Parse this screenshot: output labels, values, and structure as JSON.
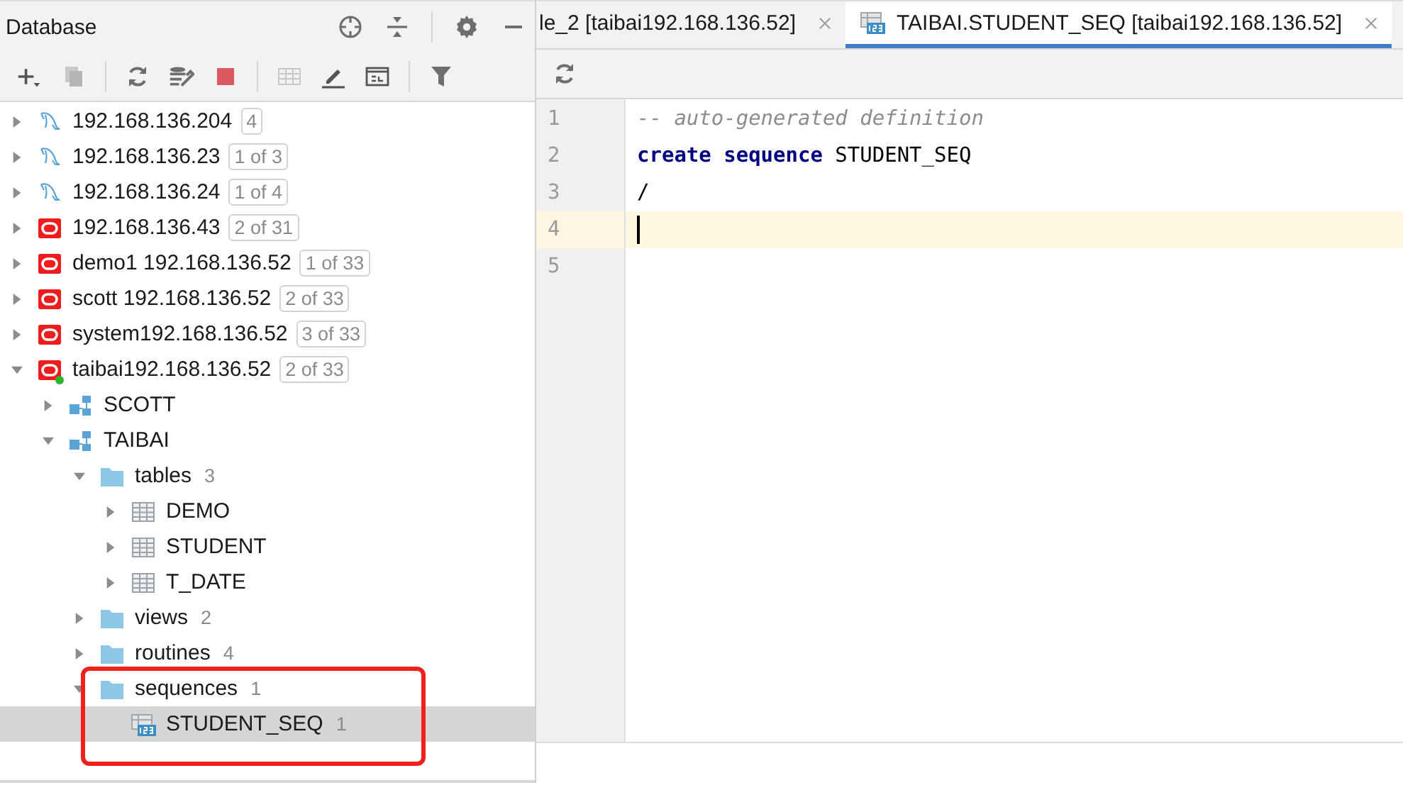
{
  "panel": {
    "title": "Database"
  },
  "tree": [
    {
      "kind": "mysql",
      "label": "192.168.136.204",
      "badge": "4",
      "expanded": false,
      "selected": false
    },
    {
      "kind": "mysql",
      "label": "192.168.136.23",
      "badge": "1 of 3",
      "expanded": false,
      "selected": false
    },
    {
      "kind": "mysql",
      "label": "192.168.136.24",
      "badge": "1 of 4",
      "expanded": false,
      "selected": false
    },
    {
      "kind": "oracle",
      "label": "192.168.136.43",
      "badge": "2 of 31",
      "expanded": false,
      "selected": false,
      "connected": false
    },
    {
      "kind": "oracle",
      "label": "demo1 192.168.136.52",
      "badge": "1 of 33",
      "expanded": false,
      "selected": false,
      "connected": false
    },
    {
      "kind": "oracle",
      "label": "scott 192.168.136.52",
      "badge": "2 of 33",
      "expanded": false,
      "selected": false,
      "connected": false
    },
    {
      "kind": "oracle",
      "label": "system192.168.136.52",
      "badge": "3 of 33",
      "expanded": false,
      "selected": false,
      "connected": false
    },
    {
      "kind": "oracle",
      "label": "taibai192.168.136.52",
      "badge": "2 of 33",
      "expanded": true,
      "selected": false,
      "connected": true,
      "children": [
        {
          "kind": "schema",
          "label": "SCOTT",
          "expanded": false,
          "selected": false
        },
        {
          "kind": "schema",
          "label": "TAIBAI",
          "expanded": true,
          "selected": false,
          "children": [
            {
              "kind": "folder",
              "label": "tables",
              "badge": "3",
              "expanded": true,
              "selected": false,
              "children": [
                {
                  "kind": "table",
                  "label": "DEMO",
                  "expanded": false,
                  "selected": false
                },
                {
                  "kind": "table",
                  "label": "STUDENT",
                  "expanded": false,
                  "selected": false
                },
                {
                  "kind": "table",
                  "label": "T_DATE",
                  "expanded": false,
                  "selected": false
                }
              ]
            },
            {
              "kind": "folder",
              "label": "views",
              "badge": "2",
              "expanded": false,
              "selected": false
            },
            {
              "kind": "folder",
              "label": "routines",
              "badge": "4",
              "expanded": false,
              "selected": false
            },
            {
              "kind": "folder",
              "label": "sequences",
              "badge": "1",
              "expanded": true,
              "selected": false,
              "children": [
                {
                  "kind": "sequence",
                  "label": "STUDENT_SEQ",
                  "badge": "1",
                  "selected": true
                }
              ]
            }
          ]
        }
      ]
    }
  ],
  "tabs": [
    {
      "label": "le_2 [taibai192.168.136.52]",
      "selected": false,
      "kind": "plain"
    },
    {
      "label": "TAIBAI.STUDENT_SEQ [taibai192.168.136.52]",
      "selected": true,
      "kind": "sequence"
    }
  ],
  "editor": {
    "lines": [
      {
        "number": "1",
        "current": false,
        "tokens": [
          {
            "kind": "comment",
            "text": "-- auto-generated definition"
          }
        ]
      },
      {
        "number": "2",
        "current": false,
        "tokens": [
          {
            "kind": "keyword",
            "text": "create sequence"
          },
          {
            "kind": "plain",
            "text": " STUDENT_SEQ"
          }
        ]
      },
      {
        "number": "3",
        "current": false,
        "tokens": [
          {
            "kind": "plain",
            "text": "/"
          }
        ]
      },
      {
        "number": "4",
        "current": true
      },
      {
        "number": "5",
        "current": false
      }
    ]
  }
}
